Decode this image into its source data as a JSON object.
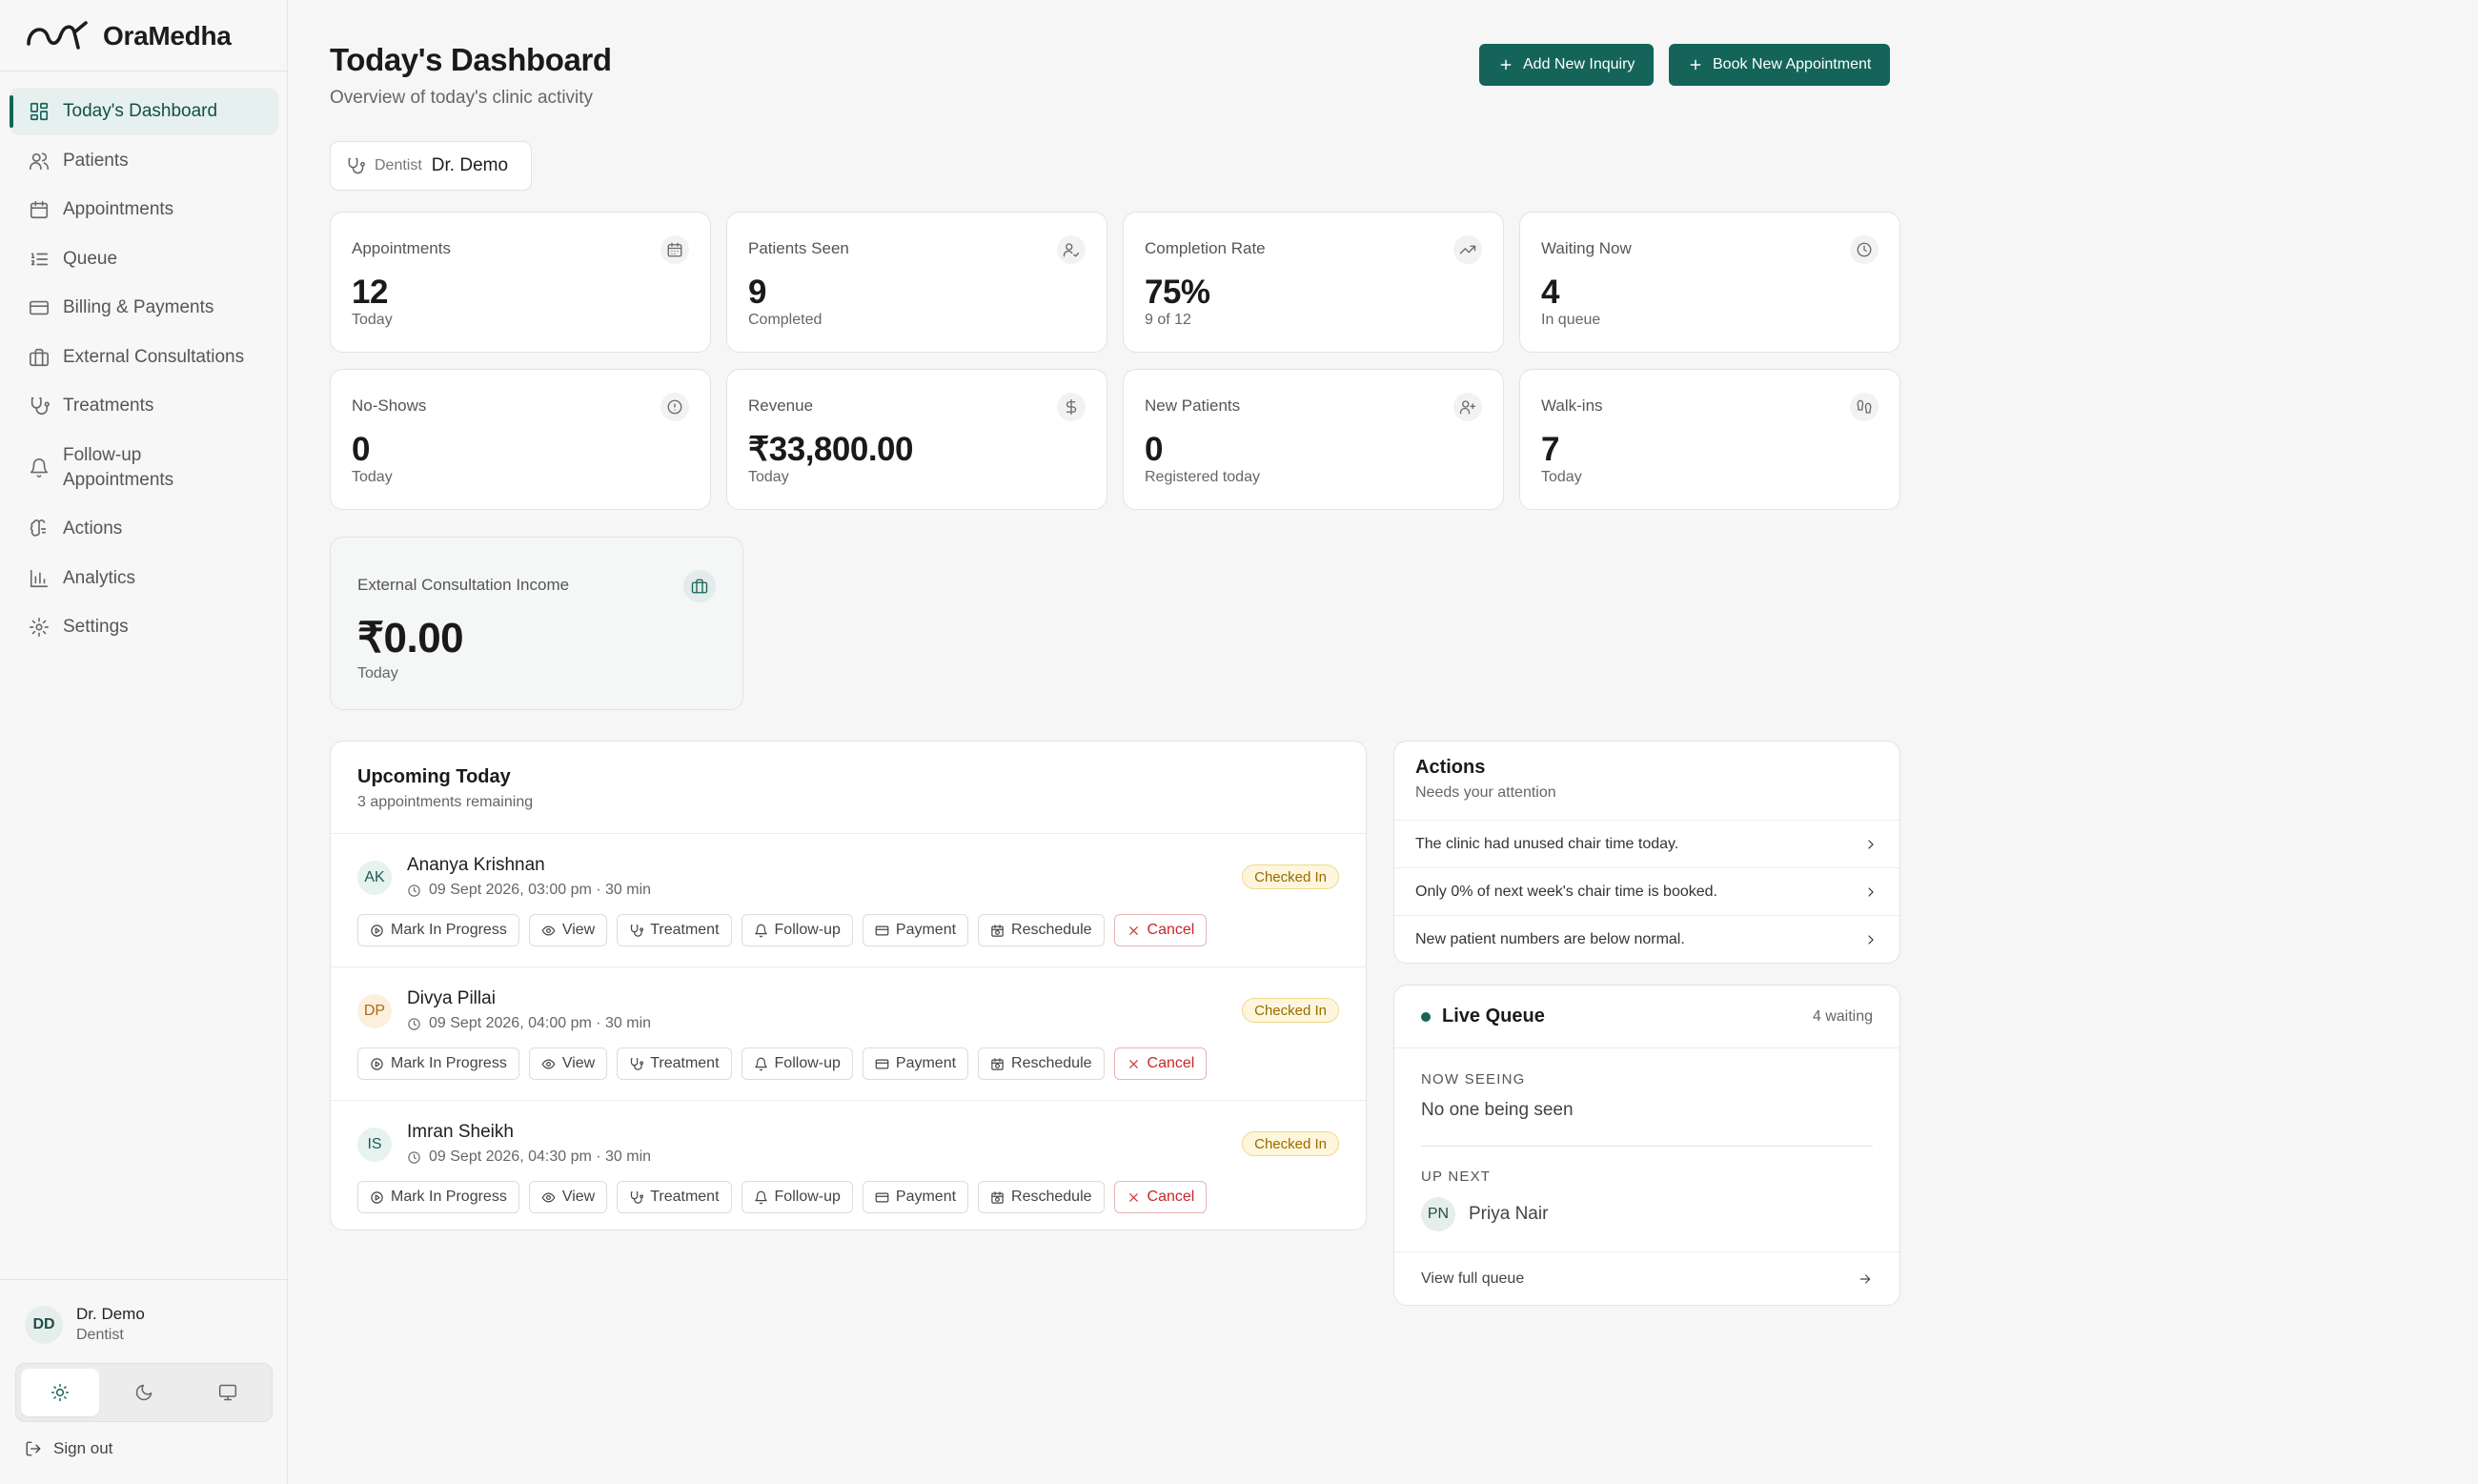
{
  "brand": {
    "name": "OraMedha"
  },
  "sidebar": {
    "items": [
      {
        "label": "Today's Dashboard",
        "icon": "dashboard-icon",
        "active": true
      },
      {
        "label": "Patients",
        "icon": "users-icon"
      },
      {
        "label": "Appointments",
        "icon": "calendar-icon"
      },
      {
        "label": "Queue",
        "icon": "list-ordered-icon"
      },
      {
        "label": "Billing & Payments",
        "icon": "credit-card-icon"
      },
      {
        "label": "External Consultations",
        "icon": "briefcase-icon"
      },
      {
        "label": "Treatments",
        "icon": "stethoscope-icon"
      },
      {
        "label": "Follow-up Appointments",
        "icon": "bell-icon"
      },
      {
        "label": "Actions",
        "icon": "brain-icon"
      },
      {
        "label": "Analytics",
        "icon": "bar-chart-icon"
      },
      {
        "label": "Settings",
        "icon": "gear-icon"
      }
    ],
    "user": {
      "initials": "DD",
      "name": "Dr. Demo",
      "role": "Dentist"
    },
    "sign_out": "Sign out"
  },
  "header": {
    "title": "Today's Dashboard",
    "subtitle": "Overview of today's clinic activity",
    "add_inquiry": "Add New Inquiry",
    "book_appointment": "Book New Appointment"
  },
  "dentist_filter": {
    "label": "Dentist",
    "value": "Dr. Demo"
  },
  "stats": [
    {
      "label": "Appointments",
      "value": "12",
      "sub": "Today",
      "icon": "calendar-icon"
    },
    {
      "label": "Patients Seen",
      "value": "9",
      "sub": "Completed",
      "icon": "user-check-icon"
    },
    {
      "label": "Completion Rate",
      "value": "75%",
      "sub": "9 of 12",
      "icon": "trending-up-icon"
    },
    {
      "label": "Waiting Now",
      "value": "4",
      "sub": "In queue",
      "icon": "clock-icon"
    },
    {
      "label": "No-Shows",
      "value": "0",
      "sub": "Today",
      "icon": "alert-circle-icon"
    },
    {
      "label": "Revenue",
      "value": "₹33,800.00",
      "sub": "Today",
      "icon": "dollar-icon"
    },
    {
      "label": "New Patients",
      "value": "0",
      "sub": "Registered today",
      "icon": "user-plus-icon"
    },
    {
      "label": "Walk-ins",
      "value": "7",
      "sub": "Today",
      "icon": "footprints-icon"
    }
  ],
  "external_income": {
    "label": "External Consultation Income",
    "value": "₹0.00",
    "sub": "Today",
    "icon": "briefcase-icon"
  },
  "upcoming": {
    "title": "Upcoming Today",
    "subtitle": "3 appointments remaining",
    "action_labels": {
      "in_progress": "Mark In Progress",
      "view": "View",
      "treatment": "Treatment",
      "follow_up": "Follow-up",
      "payment": "Payment",
      "reschedule": "Reschedule",
      "cancel": "Cancel"
    },
    "appointments": [
      {
        "initials": "AK",
        "name": "Ananya Krishnan",
        "time": "09 Sept 2026, 03:00 pm · 30 min",
        "status": "Checked In",
        "avatar_bg": "#e6f2ee",
        "avatar_fg": "#1e5a50"
      },
      {
        "initials": "DP",
        "name": "Divya Pillai",
        "time": "09 Sept 2026, 04:00 pm · 30 min",
        "status": "Checked In",
        "avatar_bg": "#fcefdc",
        "avatar_fg": "#b06a10"
      },
      {
        "initials": "IS",
        "name": "Imran Sheikh",
        "time": "09 Sept 2026, 04:30 pm · 30 min",
        "status": "Checked In",
        "avatar_bg": "#e6f2ee",
        "avatar_fg": "#1e5a50"
      }
    ]
  },
  "actions_panel": {
    "title": "Actions",
    "subtitle": "Needs your attention",
    "items": [
      "The clinic had unused chair time today.",
      "Only 0% of next week's chair time is booked.",
      "New patient numbers are below normal."
    ]
  },
  "live_queue": {
    "title": "Live Queue",
    "count": "4 waiting",
    "now_seeing_label": "NOW SEEING",
    "now_seeing_value": "No one being seen",
    "up_next_label": "UP NEXT",
    "up_next": {
      "initials": "PN",
      "name": "Priya Nair"
    },
    "view_full": "View full queue"
  },
  "colors": {
    "accent": "#14645a",
    "danger": "#c62828",
    "badge": "#9a6a00"
  }
}
